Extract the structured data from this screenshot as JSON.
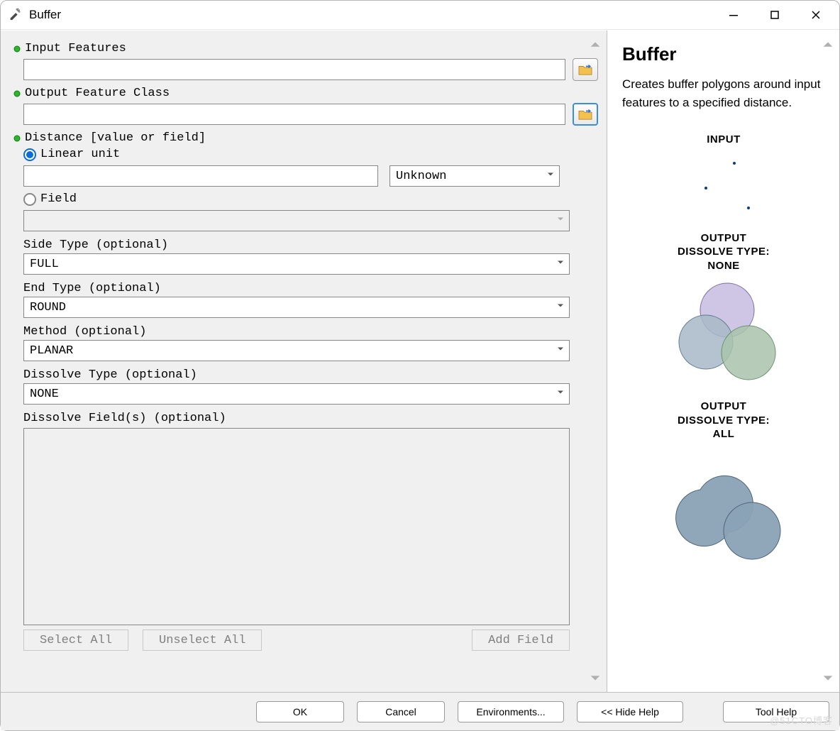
{
  "window": {
    "title": "Buffer"
  },
  "form": {
    "input_features_label": "Input Features",
    "input_features_value": "",
    "output_fc_label": "Output Feature Class",
    "output_fc_value": "",
    "distance_label": "Distance [value or field]",
    "linear_unit_label": "Linear unit",
    "linear_unit_value": "",
    "linear_unit_unit": "Unknown",
    "field_label": "Field",
    "field_value": "",
    "side_type_label": "Side Type (optional)",
    "side_type_value": "FULL",
    "end_type_label": "End Type (optional)",
    "end_type_value": "ROUND",
    "method_label": "Method (optional)",
    "method_value": "PLANAR",
    "dissolve_type_label": "Dissolve Type (optional)",
    "dissolve_type_value": "NONE",
    "dissolve_fields_label": "Dissolve Field(s) (optional)",
    "select_all": "Select All",
    "unselect_all": "Unselect All",
    "add_field": "Add Field"
  },
  "help": {
    "title": "Buffer",
    "description": "Creates buffer polygons around input features to a specified distance.",
    "illus_input": "INPUT",
    "illus_none": "OUTPUT\nDISSOLVE TYPE:\nNONE",
    "illus_all": "OUTPUT\nDISSOLVE TYPE:\nALL"
  },
  "footer": {
    "ok": "OK",
    "cancel": "Cancel",
    "environments": "Environments...",
    "hide_help": "<< Hide Help",
    "tool_help": "Tool Help"
  },
  "watermark": "@51CTO博客"
}
